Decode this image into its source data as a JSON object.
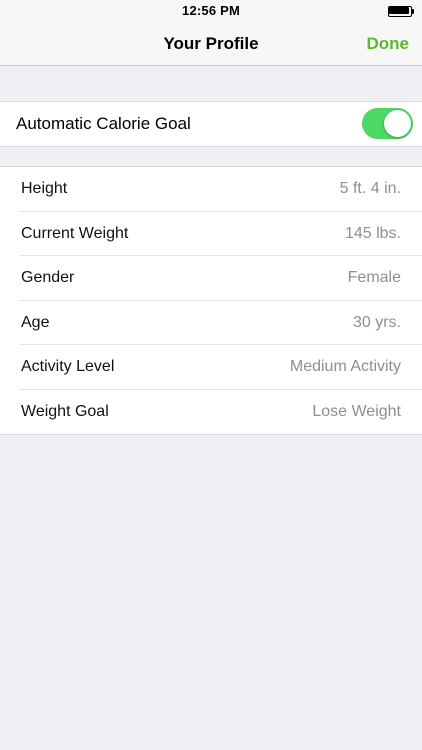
{
  "status_bar": {
    "time": "12:56 PM",
    "battery_icon": "battery-full-icon"
  },
  "nav": {
    "title": "Your Profile",
    "done_label": "Done",
    "accent_color": "#5cb82e"
  },
  "auto_calorie": {
    "label": "Automatic Calorie Goal",
    "enabled": true,
    "switch_color": "#4cd964"
  },
  "profile": {
    "rows": [
      {
        "label": "Height",
        "value": "5 ft. 4 in."
      },
      {
        "label": "Current Weight",
        "value": "145 lbs."
      },
      {
        "label": "Gender",
        "value": "Female"
      },
      {
        "label": "Age",
        "value": "30 yrs."
      },
      {
        "label": "Activity Level",
        "value": "Medium Activity"
      },
      {
        "label": "Weight Goal",
        "value": "Lose Weight"
      }
    ]
  }
}
